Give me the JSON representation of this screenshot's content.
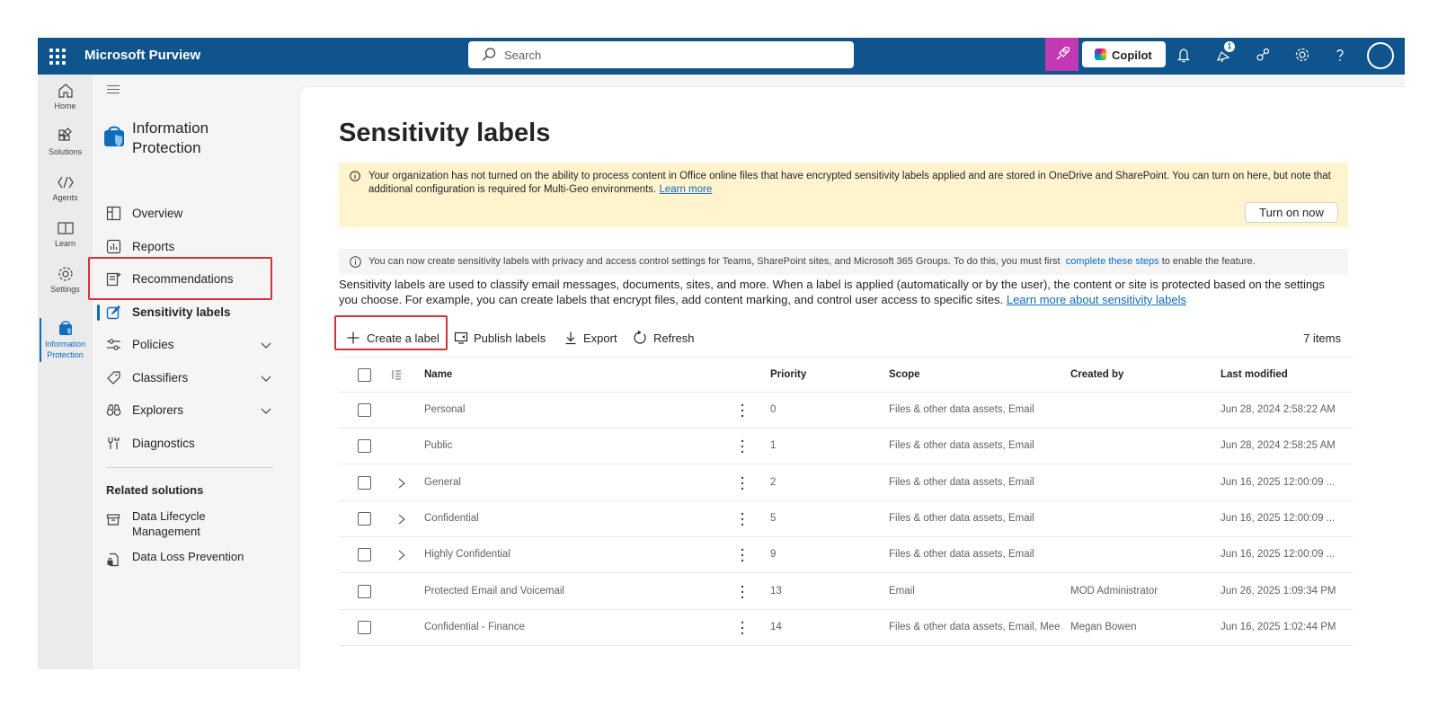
{
  "app": {
    "title": "Microsoft Purview"
  },
  "search": {
    "placeholder": "Search"
  },
  "topbar": {
    "copilot_label": "Copilot",
    "notification_badge": "1"
  },
  "rail": {
    "items": [
      {
        "label": "Home",
        "icon": "home-icon"
      },
      {
        "label": "Solutions",
        "icon": "solutions-icon"
      },
      {
        "label": "Agents",
        "icon": "agents-icon"
      },
      {
        "label": "Learn",
        "icon": "learn-icon"
      },
      {
        "label": "Settings",
        "icon": "settings-icon"
      },
      {
        "label": "Information Protection",
        "icon": "information-protection-icon"
      }
    ]
  },
  "nav": {
    "title": "Information Protection",
    "items": [
      {
        "label": "Overview"
      },
      {
        "label": "Reports"
      },
      {
        "label": "Recommendations"
      },
      {
        "label": "Sensitivity labels"
      },
      {
        "label": "Policies"
      },
      {
        "label": "Classifiers"
      },
      {
        "label": "Explorers"
      },
      {
        "label": "Diagnostics"
      }
    ],
    "related_title": "Related solutions",
    "related": [
      {
        "label": "Data Lifecycle Management"
      },
      {
        "label": "Data Loss Prevention"
      }
    ]
  },
  "main": {
    "title": "Sensitivity labels",
    "warning": {
      "text": "Your organization has not turned on the ability to process content in Office online files that have encrypted sensitivity labels applied and are stored in OneDrive and SharePoint. You can turn on here, but note that additional configuration is required for Multi-Geo environments.",
      "link": "Learn more",
      "button": "Turn on now"
    },
    "info": {
      "text_before": "You can now create sensitivity labels with privacy and access control settings for Teams, SharePoint sites, and Microsoft 365 Groups. To do this, you must first",
      "link": "complete these steps",
      "text_after": "to enable the feature."
    },
    "description": {
      "text": "Sensitivity labels are used to classify email messages, documents, sites, and more. When a label is applied (automatically or by the user), the content or site is protected based on the settings you choose. For example, you can create labels that encrypt files, add content marking, and control user access to specific sites.",
      "link": "Learn more about sensitivity labels"
    },
    "toolbar": {
      "create": "Create a label",
      "publish": "Publish labels",
      "export": "Export",
      "refresh": "Refresh",
      "count": "7 items"
    },
    "table": {
      "columns": [
        "Name",
        "Priority",
        "Scope",
        "Created by",
        "Last modified"
      ],
      "rows": [
        {
          "name": "Personal",
          "priority": "0",
          "scope": "Files & other data assets, Email",
          "created_by": "",
          "modified": "Jun 28, 2024 2:58:22 AM",
          "expandable": false
        },
        {
          "name": "Public",
          "priority": "1",
          "scope": "Files & other data assets, Email",
          "created_by": "",
          "modified": "Jun 28, 2024 2:58:25 AM",
          "expandable": false
        },
        {
          "name": "General",
          "priority": "2",
          "scope": "Files & other data assets, Email",
          "created_by": "",
          "modified": "Jun 16, 2025 12:00:09 ...",
          "expandable": true
        },
        {
          "name": "Confidential",
          "priority": "5",
          "scope": "Files & other data assets, Email",
          "created_by": "",
          "modified": "Jun 16, 2025 12:00:09 ...",
          "expandable": true
        },
        {
          "name": "Highly Confidential",
          "priority": "9",
          "scope": "Files & other data assets, Email",
          "created_by": "",
          "modified": "Jun 16, 2025 12:00:09 ...",
          "expandable": true
        },
        {
          "name": "Protected Email and Voicemail",
          "priority": "13",
          "scope": "Email",
          "created_by": "MOD Administrator",
          "modified": "Jun 26, 2025 1:09:34 PM",
          "expandable": false
        },
        {
          "name": "Confidential - Finance",
          "priority": "14",
          "scope": "Files & other data assets, Email, Mee...",
          "created_by": "Megan Bowen",
          "modified": "Jun 16, 2025 1:02:44 PM",
          "expandable": false
        }
      ]
    }
  },
  "colors": {
    "topbar": "#0f548c",
    "accent": "#0f6cbd",
    "highlight_outline": "#d13438",
    "warning_bg": "#fff4ce",
    "copilot_button": "#c239b3"
  }
}
